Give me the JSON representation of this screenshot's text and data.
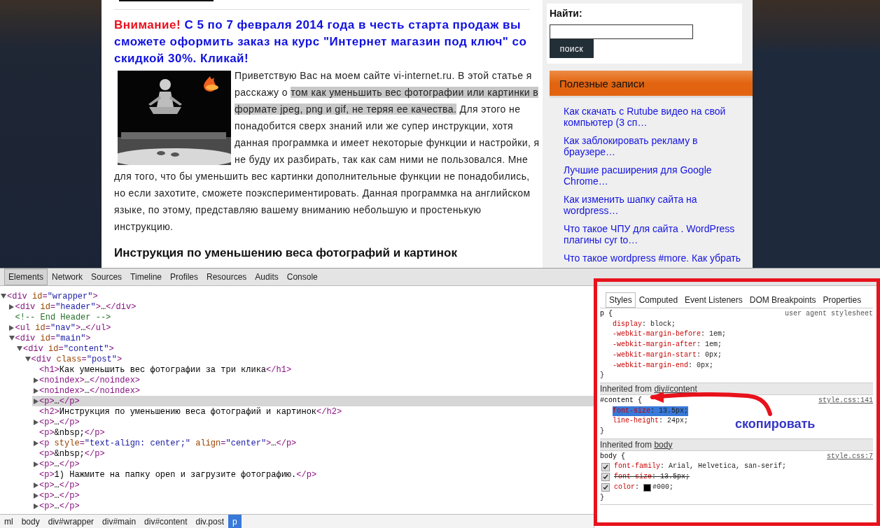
{
  "page": {
    "announcement": {
      "label": "Внимание!",
      "text": "С 5 по 7 февраля 2014 года в честь старта продаж  вы сможете оформить заказ на курс \"Интернет магазин под ключ\" со скидкой 30%. Кликай!"
    },
    "article": {
      "intro_before": "Приветствую Вас на моем сайте vi-internet.ru. В этой статье я расскажу о ",
      "intro_highlighted": "том как уменьшить вес фотографии или картинки в формате jpeg, png и gif, не теряя ее качества.",
      "intro_after": " Для этого не понадобится сверх знаний или же супер инструкции, хотя данная программка и имеет некоторые функции и настройки, я не буду их разбирать, так как сам ними не пользовался. Мне для того, что бы уменьшить вес картинки дополнительные функции не понадобились, но если захотите, сможете поэкспериментировать. Данная программка на английском языке, по этому, представляю вашему вниманию небольшую и простенькую инструкцию.",
      "heading": "Инструкция по уменьшению веса фотографий и картинок"
    },
    "sidebar": {
      "search_label": "Найти:",
      "search_button": "поиск",
      "widget_title": "Полезные записи",
      "links": [
        "Как скачать с Rutube видео на свой компьютер (3 сп…",
        "Как заблокировать рекламу в браузере…",
        "Лучшие расширения для Google Chrome…",
        "Как изменить шапку сайта на wordpress…",
        "Что такое ЧПУ для сайта . WordPress плагины cyr to…",
        "Что такое wordpress #more. Как убрать"
      ]
    }
  },
  "devtools": {
    "tabs": [
      {
        "label": "Elements",
        "selected": true
      },
      {
        "label": "Network",
        "selected": false
      },
      {
        "label": "Sources",
        "selected": false
      },
      {
        "label": "Timeline",
        "selected": false
      },
      {
        "label": "Profiles",
        "selected": false
      },
      {
        "label": "Resources",
        "selected": false
      },
      {
        "label": "Audits",
        "selected": false
      },
      {
        "label": "Console",
        "selected": false
      }
    ],
    "dom_tree": [
      {
        "markup": "<div id=\"wrapper\">",
        "expanded": true,
        "selected": false,
        "children": [
          {
            "markup": "<div id=\"header\">…</div>",
            "expanded": false,
            "selected": false
          },
          {
            "markup": "<!-- End Header -->",
            "selected": false
          },
          {
            "markup": "<ul id=\"nav\">…</ul>",
            "expanded": false,
            "selected": false
          },
          {
            "markup": "<div id=\"main\">",
            "expanded": true,
            "selected": false,
            "children": [
              {
                "markup": "<div id=\"content\">",
                "expanded": true,
                "selected": false,
                "children": [
                  {
                    "markup": "<div class=\"post\">",
                    "expanded": true,
                    "selected": false,
                    "children": [
                      {
                        "markup": "<h1>Как уменьшить вес фотографии за три клика</h1>",
                        "selected": false
                      },
                      {
                        "markup": "<noindex>…</noindex>",
                        "expanded": false,
                        "selected": false
                      },
                      {
                        "markup": "<noindex>…</noindex>",
                        "expanded": false,
                        "selected": false
                      },
                      {
                        "markup": "<p>…</p>",
                        "expanded": false,
                        "selected": true
                      },
                      {
                        "markup": "<h2>Инструкция по уменьшению веса фотографий и картинок</h2>",
                        "selected": false
                      },
                      {
                        "markup": "<p>…</p>",
                        "expanded": false,
                        "selected": false
                      },
                      {
                        "markup": "<p>&nbsp;</p>",
                        "selected": false
                      },
                      {
                        "markup": "<p style=\"text-align: center;\" align=\"center\">…</p>",
                        "expanded": false,
                        "selected": false
                      },
                      {
                        "markup": "<p>&nbsp;</p>",
                        "selected": false
                      },
                      {
                        "markup": "<p>…</p>",
                        "expanded": false,
                        "selected": false
                      },
                      {
                        "markup": "<p>1) Нажмите на папку open и загрузите фотографию.</p>",
                        "selected": false
                      },
                      {
                        "markup": "<p>…</p>",
                        "expanded": false,
                        "selected": false
                      },
                      {
                        "markup": "<p>…</p>",
                        "expanded": false,
                        "selected": false
                      },
                      {
                        "markup": "<p>…</p>",
                        "expanded": false,
                        "selected": false
                      }
                    ]
                  }
                ]
              }
            ]
          }
        ]
      }
    ],
    "breadcrumbs": [
      {
        "label": "ml",
        "selected": false
      },
      {
        "label": "body",
        "selected": false
      },
      {
        "label": "div#wrapper",
        "selected": false
      },
      {
        "label": "div#main",
        "selected": false
      },
      {
        "label": "div#content",
        "selected": false
      },
      {
        "label": "div.post",
        "selected": false
      },
      {
        "label": "p",
        "selected": true
      }
    ],
    "styles_tabs": [
      {
        "label": "Styles",
        "selected": true
      },
      {
        "label": "Computed",
        "selected": false
      },
      {
        "label": "Event Listeners",
        "selected": false
      },
      {
        "label": "DOM Breakpoints",
        "selected": false
      },
      {
        "label": "Properties",
        "selected": false
      }
    ],
    "rules": [
      {
        "kind": "rule",
        "selector": "p {",
        "source": "user agent stylesheet",
        "source_is_link": false,
        "close": "}",
        "properties": [
          {
            "name": "display",
            "colon": ":",
            "value": "block;"
          },
          {
            "name": "-webkit-margin-before",
            "colon": ":",
            "value": "1em;"
          },
          {
            "name": "-webkit-margin-after",
            "colon": ":",
            "value": "1em;"
          },
          {
            "name": "-webkit-margin-start",
            "colon": ":",
            "value": "0px;"
          },
          {
            "name": "-webkit-margin-end",
            "colon": ":",
            "value": "0px;"
          }
        ]
      },
      {
        "kind": "inherited",
        "label": "Inherited from",
        "link": "div#content"
      },
      {
        "kind": "rule",
        "selector": "#content {",
        "source": "style.css:141",
        "source_is_link": true,
        "close": "}",
        "properties": [
          {
            "name": "font-size",
            "colon": ":",
            "value": "13.5px;",
            "selected": true
          },
          {
            "name": "line-height",
            "colon": ":",
            "value": "24px;",
            "selected": false
          }
        ]
      },
      {
        "kind": "inherited",
        "label": "Inherited from",
        "link": "body"
      },
      {
        "kind": "rule",
        "selector": "body {",
        "source": "style.css:7",
        "source_is_link": true,
        "close": "}",
        "properties": [
          {
            "name": "font-family",
            "colon": ":",
            "value": "Arial, Helvetica, san-serif;",
            "checked": true,
            "overridden": false
          },
          {
            "name": "font-size",
            "colon": ":",
            "value": "13.5px;",
            "checked": true,
            "overridden": true
          },
          {
            "name": "color",
            "colon": ":",
            "value": "#000;",
            "checked": true,
            "overridden": false,
            "color": "#000000"
          }
        ]
      }
    ],
    "annotation": {
      "text": "скопировать"
    }
  }
}
